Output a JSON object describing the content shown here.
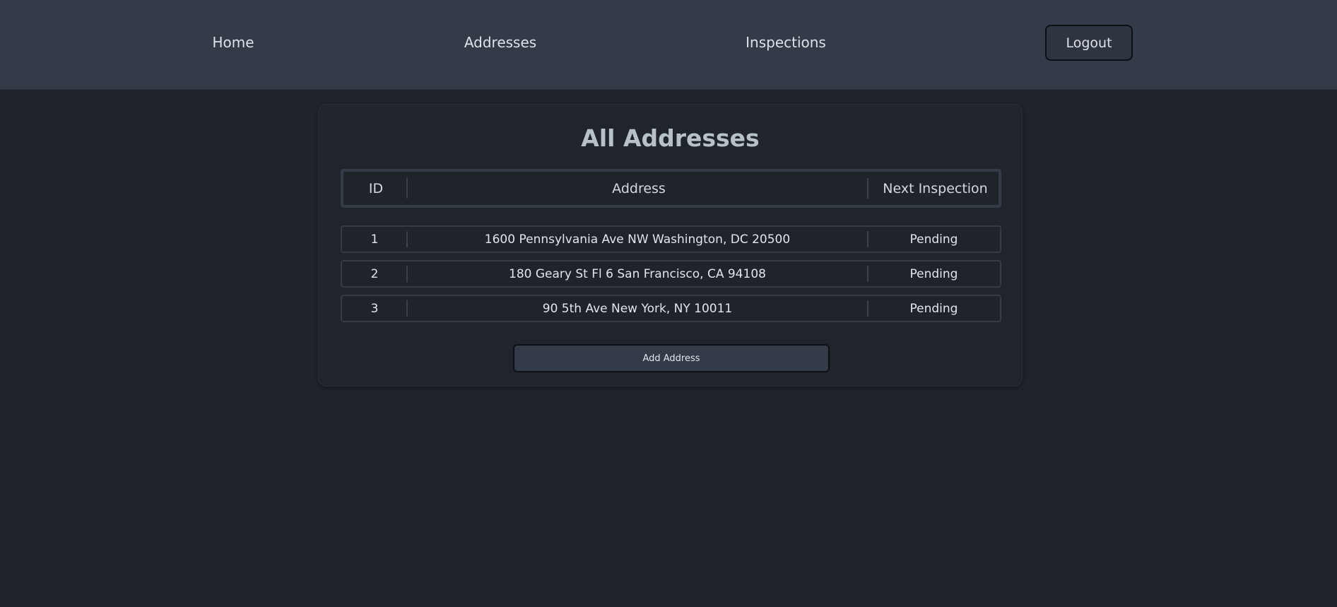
{
  "nav": {
    "home": "Home",
    "addresses": "Addresses",
    "inspections": "Inspections",
    "logout": "Logout"
  },
  "main": {
    "title": "All Addresses",
    "table": {
      "headers": {
        "id": "ID",
        "address": "Address",
        "next_inspection": "Next Inspection"
      },
      "rows": [
        {
          "id": "1",
          "address": "1600 Pennsylvania Ave NW Washington, DC 20500",
          "next_inspection": "Pending"
        },
        {
          "id": "2",
          "address": "180 Geary St Fl 6 San Francisco, CA 94108",
          "next_inspection": "Pending"
        },
        {
          "id": "3",
          "address": "90 5th Ave New York, NY 10011",
          "next_inspection": "Pending"
        }
      ]
    },
    "add_button": "Add Address"
  },
  "colors": {
    "background": "#1f232a",
    "navbar": "#343b48",
    "title": "#b7c2c6"
  }
}
